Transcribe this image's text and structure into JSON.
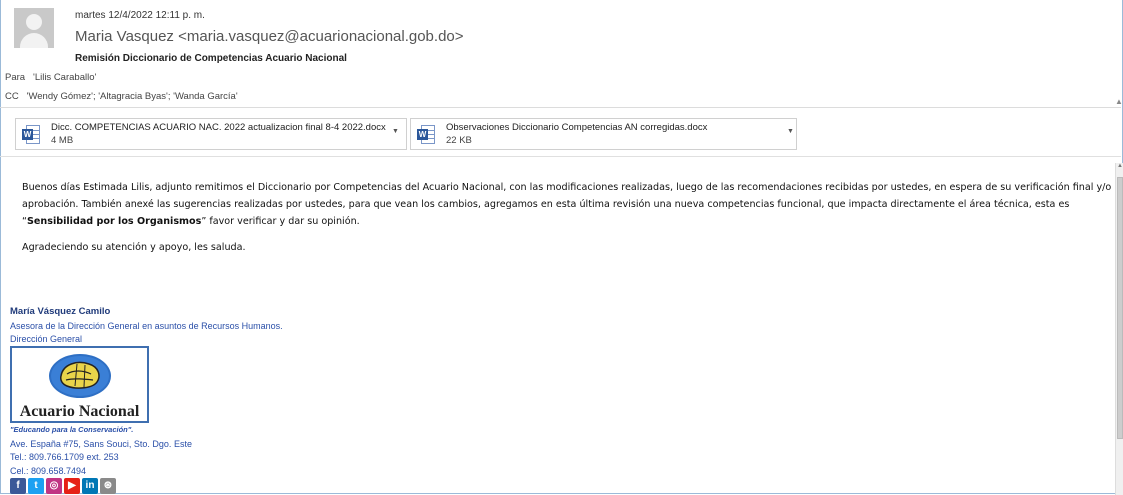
{
  "header": {
    "date": "martes 12/4/2022 12:11 p. m.",
    "from": "Maria Vasquez <maria.vasquez@acuarionacional.gob.do>",
    "subject": "Remisión Diccionario de Competencias Acuario Nacional",
    "to_label": "Para",
    "to_value": "'Lilis Caraballo'",
    "cc_label": "CC",
    "cc_value": "'Wendy Gómez'; 'Altagracia Byas'; 'Wanda García'"
  },
  "attachments": [
    {
      "name": "Dicc. COMPETENCIAS ACUARIO NAC. 2022 actualizacion final 8-4 2022.docx",
      "size": "4 MB",
      "icon": "word-doc-icon"
    },
    {
      "name": "Observaciones Diccionario Competencias AN corregidas.docx",
      "size": "22 KB",
      "icon": "word-doc-icon"
    }
  ],
  "body": {
    "paragraph_part1": "Buenos días Estimada Lilis, adjunto remitimos el Diccionario por Competencias del Acuario Nacional, con las modificaciones realizadas, luego de las  recomendaciones recibidas por ustedes, en espera de su verificación final y/o aprobación. También anexé las sugerencias realizadas por ustedes, para que vean los cambios, agregamos en esta última revisión una nueva competencias funcional, que impacta directamente el área técnica,  esta es “",
    "paragraph_bold": "Sensibilidad por los Organismos",
    "paragraph_part2": "” favor verificar y dar su opinión.",
    "closing": "Agradeciendo su atención y apoyo, les saluda."
  },
  "signature": {
    "name": "María Vásquez Camilo",
    "role": "Asesora de la Dirección General en asuntos de Recursos Humanos.",
    "department": "Dirección General",
    "logo_text": "Acuario Nacional",
    "slogan": "\"Educando para la Conservación\".",
    "address": "Ave. España #75, Sans Souci, Sto. Dgo. Este",
    "tel": "Tel.:  809.766.1709 ext. 253",
    "cel": "Cel.:  809.658.7494",
    "social": [
      {
        "icon": "facebook-icon",
        "glyph": "f",
        "color": "#3b5998"
      },
      {
        "icon": "twitter-icon",
        "glyph": "t",
        "color": "#1da1f2"
      },
      {
        "icon": "instagram-icon",
        "glyph": "◎",
        "color": "#c13584"
      },
      {
        "icon": "youtube-icon",
        "glyph": "▶",
        "color": "#e62117"
      },
      {
        "icon": "linkedin-icon",
        "glyph": "in",
        "color": "#0077b5"
      },
      {
        "icon": "dribbble-icon",
        "glyph": "⊛",
        "color": "#8a8a8a"
      }
    ]
  }
}
